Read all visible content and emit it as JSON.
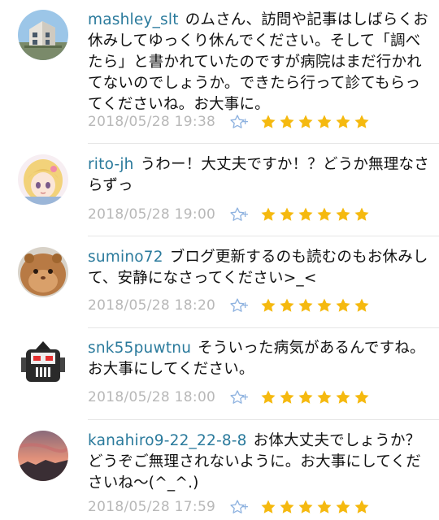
{
  "colors": {
    "username": "#2a7a9c",
    "timestamp": "#b8b8b8",
    "star": "#f5b90f",
    "star_add": "#8fb3e0"
  },
  "star_add_plus": "+",
  "comments": [
    {
      "username": "mashley_slt",
      "text": "のムさん、訪問や記事はしばらくお休みしてゆっくり休んでください。そして「調べたら」と書かれていたのですが病院はまだ行かれてないのでしょうか。できたら行って診てもらってくださいね。お大事に。",
      "timestamp": "2018/05/28 19:38",
      "stars": 6,
      "avatar_icon": "house-photo-avatar"
    },
    {
      "username": "rito-jh",
      "text": "うわー！大丈夫ですか！？どうか無理なさらずっ",
      "timestamp": "2018/05/28 19:00",
      "stars": 6,
      "avatar_icon": "anime-girl-avatar"
    },
    {
      "username": "sumino72",
      "text": "ブログ更新するのも読むのもお休みして、安静になさってください>_<",
      "timestamp": "2018/05/28 18:20",
      "stars": 6,
      "avatar_icon": "hamster-avatar"
    },
    {
      "username": "snk55puwtnu",
      "text": "そういった病気があるんですね。お大事にしてください。",
      "timestamp": "2018/05/28 18:00",
      "stars": 6,
      "avatar_icon": "robot-avatar"
    },
    {
      "username": "kanahiro9-22_22-8-8",
      "text": "お体大丈夫でしょうか？どうぞご無理されないように。お大事にしてくださいね〜(^_^.)",
      "timestamp": "2018/05/28 17:59",
      "stars": 6,
      "avatar_icon": "sunset-avatar"
    }
  ]
}
